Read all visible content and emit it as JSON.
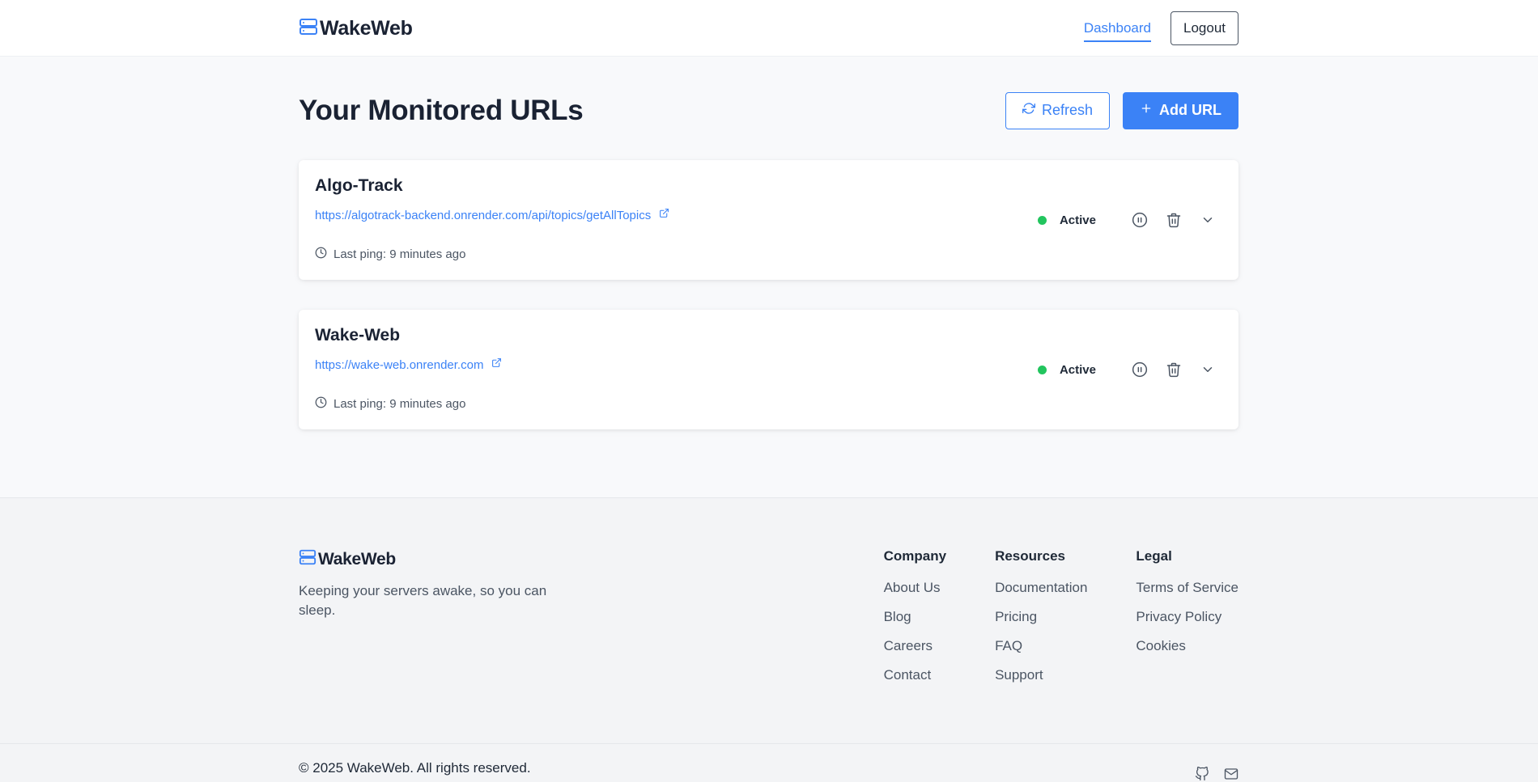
{
  "header": {
    "brand": "WakeWeb",
    "nav_dashboard": "Dashboard",
    "logout": "Logout"
  },
  "main": {
    "title": "Your Monitored URLs",
    "refresh_label": "Refresh",
    "add_label": "Add URL",
    "monitors": [
      {
        "name": "Algo-Track",
        "url": "https://algotrack-backend.onrender.com/api/topics/getAllTopics",
        "last_ping": "Last ping: 9 minutes ago",
        "status": "Active"
      },
      {
        "name": "Wake-Web",
        "url": "https://wake-web.onrender.com",
        "last_ping": "Last ping: 9 minutes ago",
        "status": "Active"
      }
    ]
  },
  "footer": {
    "brand": "WakeWeb",
    "tagline": "Keeping your servers awake, so you can sleep.",
    "columns": [
      {
        "title": "Company",
        "links": [
          "About Us",
          "Blog",
          "Careers",
          "Contact"
        ]
      },
      {
        "title": "Resources",
        "links": [
          "Documentation",
          "Pricing",
          "FAQ",
          "Support"
        ]
      },
      {
        "title": "Legal",
        "links": [
          "Terms of Service",
          "Privacy Policy",
          "Cookies"
        ]
      }
    ],
    "copyright": "© 2025 WakeWeb. All rights reserved.",
    "social_icons": [
      "github-icon",
      "mail-icon"
    ]
  },
  "colors": {
    "accent": "#3b82f6",
    "status_active": "#22c55e"
  }
}
